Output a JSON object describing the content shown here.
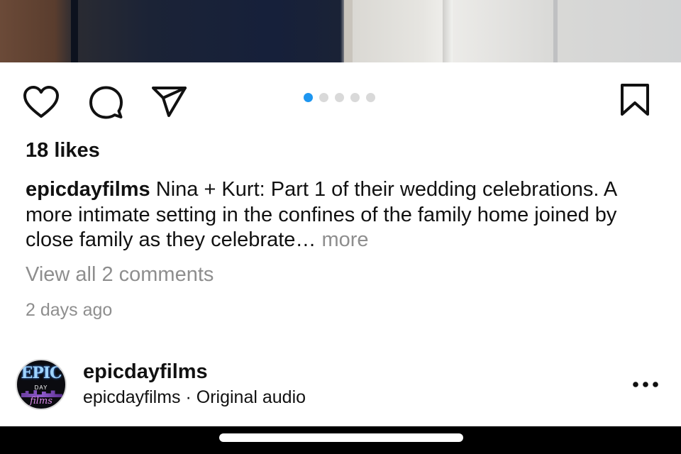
{
  "post": {
    "carousel": {
      "total": 5,
      "active": 1
    },
    "likes": "18 likes",
    "caption": {
      "username": "epicdayfilms",
      "text": " Nina + Kurt: Part 1 of their wedding celebrations. A more intimate setting in the confines of the family home joined by close family as they celebrate…",
      "more_label": " more"
    },
    "view_comments": "View all 2 comments",
    "timestamp": "2 days ago"
  },
  "actions": {
    "like_icon": "heart-icon",
    "comment_icon": "comment-bubble-icon",
    "share_icon": "paper-plane-icon",
    "save_icon": "bookmark-icon"
  },
  "audio": {
    "account_name": "epicdayfilms",
    "audio_line": "epicdayfilms · Original audio",
    "avatar_logo": {
      "top": "EPIC",
      "mid": "DAY",
      "bottom": "films"
    },
    "more_icon": "more-horizontal-icon"
  },
  "colors": {
    "carousel_active": "#1d96f0",
    "carousel_inactive": "#d9d9d9",
    "secondary_text": "#8e8e8e"
  }
}
